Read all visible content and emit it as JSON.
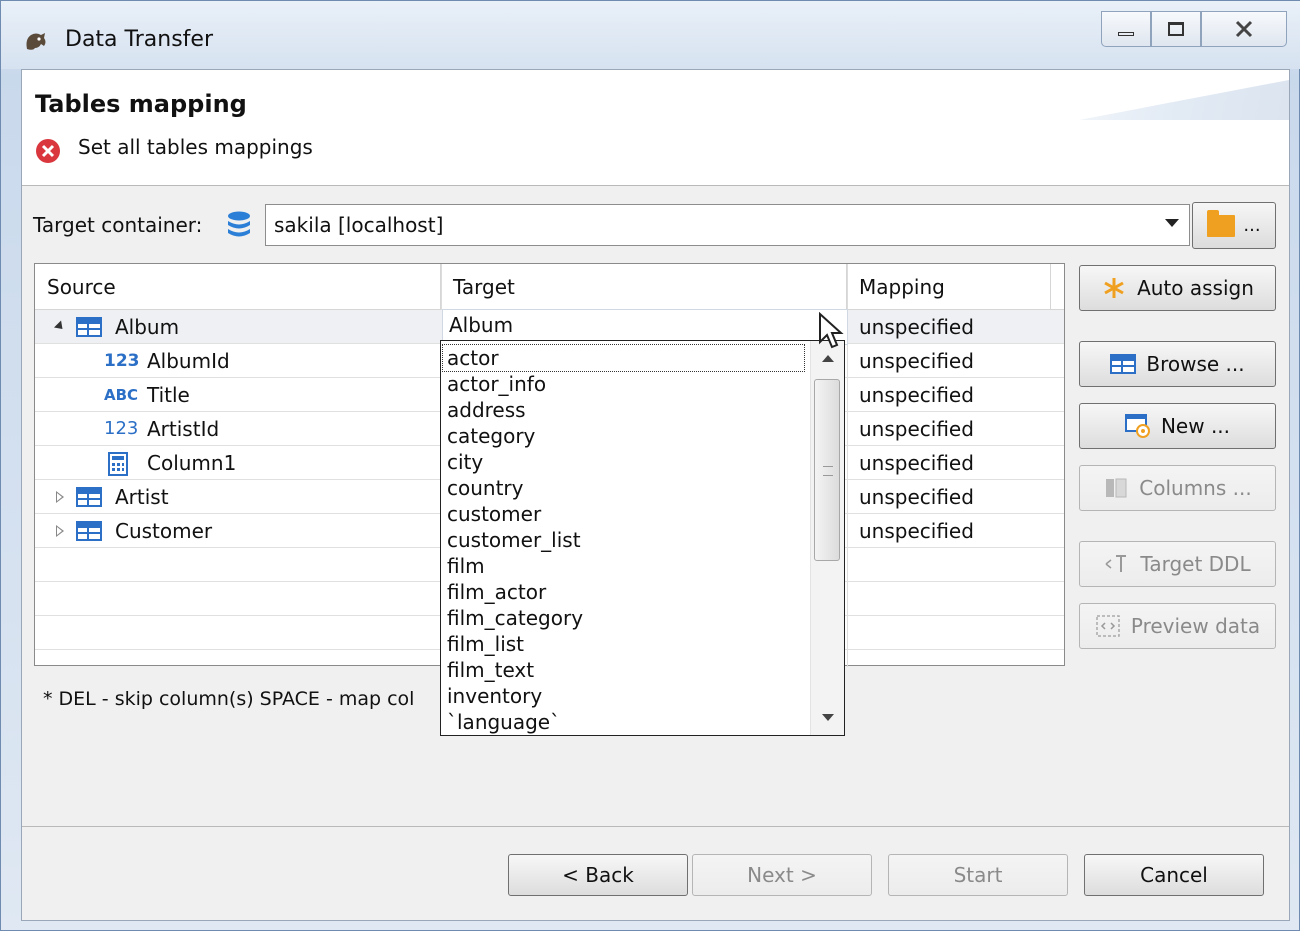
{
  "window": {
    "title": "Data Transfer"
  },
  "header": {
    "title": "Tables mapping",
    "message": "Set all tables mappings"
  },
  "target_container": {
    "label": "Target container:",
    "value": "sakila  [localhost]",
    "folder_button": "..."
  },
  "table": {
    "columns": [
      "Source",
      "Target",
      "Mapping"
    ],
    "rows": [
      {
        "source": "Album",
        "target": "Album",
        "mapping": "unspecified"
      },
      {
        "source": "AlbumId",
        "mapping": "unspecified"
      },
      {
        "source": "Title",
        "mapping": "unspecified"
      },
      {
        "source": "ArtistId",
        "mapping": "unspecified"
      },
      {
        "source": "Column1",
        "mapping": "unspecified"
      },
      {
        "source": "Artist",
        "mapping": "unspecified"
      },
      {
        "source": "Customer",
        "mapping": "unspecified"
      }
    ],
    "type_icons": {
      "numeric_key": "123",
      "text": "ABC",
      "numeric": "123"
    }
  },
  "dropdown": {
    "items": [
      "actor",
      "actor_info",
      "address",
      "category",
      "city",
      "country",
      "customer",
      "customer_list",
      "film",
      "film_actor",
      "film_category",
      "film_list",
      "film_text",
      "inventory",
      "`language`"
    ]
  },
  "buttons": {
    "auto_assign": "Auto assign",
    "browse": "Browse ...",
    "new": "New ...",
    "columns": "Columns ...",
    "target_ddl": "Target DDL",
    "preview_data": "Preview data"
  },
  "hint": "* DEL - skip column(s)  SPACE - map col",
  "footer": {
    "back": "< Back",
    "next": "Next >",
    "start": "Start",
    "cancel": "Cancel"
  },
  "colors": {
    "accent": "#2b6fc6",
    "error": "#d9363e",
    "folder": "#f0a020"
  }
}
